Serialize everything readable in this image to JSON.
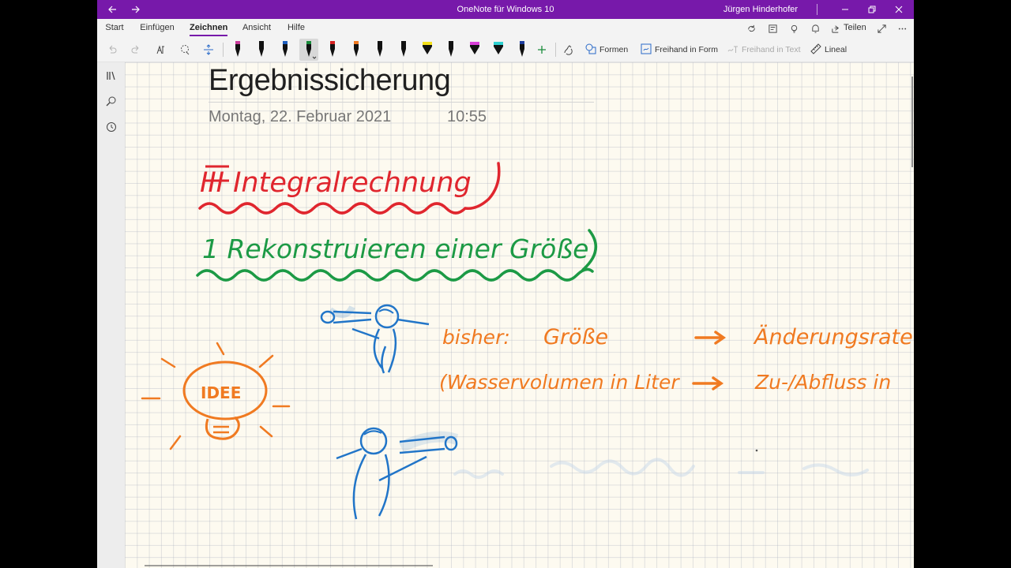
{
  "window": {
    "title": "OneNote für Windows 10",
    "user": "Jürgen Hinderhofer"
  },
  "ribbon": {
    "tabs": [
      "Start",
      "Einfügen",
      "Zeichnen",
      "Ansicht",
      "Hilfe"
    ],
    "active_tab": "Zeichnen",
    "share_label": "Teilen"
  },
  "toolbar": {
    "pen_colors": [
      "#c93c9a",
      "#111111",
      "#1f5fbf",
      "#1a8c3c",
      "#d62222",
      "#f07a21",
      "#111111",
      "#111111",
      "#f5e11a",
      "#111111",
      "#d93ed9",
      "#2ed0d0",
      "#1f3f9f"
    ],
    "shapes_label": "Formen",
    "ink_to_shape_label": "Freihand in Form",
    "ink_to_text_label": "Freihand in Text",
    "ruler_label": "Lineal"
  },
  "page": {
    "title": "Ergebnissicherung",
    "date": "Montag, 22. Februar 2021",
    "time": "10:55"
  },
  "ink": {
    "heading_red": "III  Integralrechnung",
    "heading_green": "1  Rekonstruieren einer Größe",
    "idea": "IDEE",
    "row1_left": "bisher:",
    "row1_mid": "Größe",
    "row1_right": "Änderungsrate",
    "row2_mid": "(Wasservolumen in Liter",
    "row2_right": "Zu-/Abfluss in",
    "colors": {
      "red": "#e0262e",
      "green": "#1c9a45",
      "orange": "#f07a21",
      "blue": "#2175c8"
    }
  }
}
